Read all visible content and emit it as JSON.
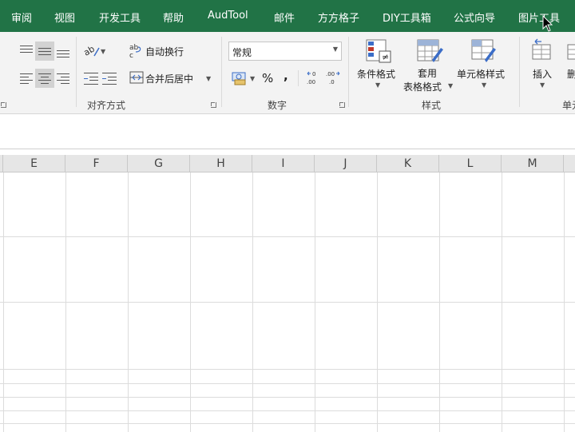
{
  "tabs": [
    "审阅",
    "视图",
    "开发工具",
    "帮助",
    "AudTool",
    "邮件",
    "方方格子",
    "DIY工具箱",
    "公式向导",
    "图片工具"
  ],
  "ribbon": {
    "alignment": {
      "wrap_text": "自动换行",
      "merge_center": "合并后居中",
      "group_label": "对齐方式"
    },
    "number": {
      "format_value": "常规",
      "percent": "%",
      "comma": ",",
      "group_label": "数字"
    },
    "styles": {
      "conditional_format": "条件格式",
      "table_format_line1": "套用",
      "table_format_line2": "表格格式",
      "cell_styles": "单元格样式",
      "group_label": "样式"
    },
    "cells": {
      "insert": "插入",
      "delete": "删",
      "group_label": "单元"
    }
  },
  "columns": [
    "E",
    "F",
    "G",
    "H",
    "I",
    "J",
    "K",
    "L",
    "M"
  ],
  "colors": {
    "tab_bar": "#217346",
    "ribbon_bg": "#f3f3f3",
    "header_bg": "#e6e6e6"
  }
}
